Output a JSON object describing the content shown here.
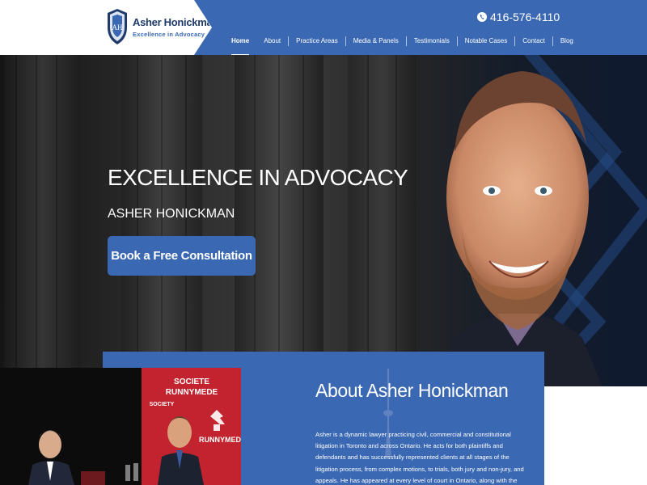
{
  "brand": {
    "name": "Asher Honickman",
    "tagline": "Excellence in Advocacy",
    "monogram": "AH",
    "icon": "shield-logo-icon",
    "colors": {
      "primary": "#3a68b3",
      "navy": "#1f3a6b"
    }
  },
  "header": {
    "phone": "416-576-4110",
    "phone_icon": "phone-icon"
  },
  "nav": {
    "items": [
      {
        "label": "Home",
        "active": true
      },
      {
        "label": "About"
      },
      {
        "label": "Practice Areas"
      },
      {
        "label": "Media & Panels"
      },
      {
        "label": "Testimonials"
      },
      {
        "label": "Notable Cases"
      },
      {
        "label": "Contact"
      },
      {
        "label": "Blog"
      }
    ]
  },
  "hero": {
    "title": "EXCELLENCE IN ADVOCACY",
    "subtitle": "ASHER HONICKMAN",
    "cta_label": "Book a Free Consultation"
  },
  "photo": {
    "banner_text_1": "SOCIETE",
    "banner_text_2": "RUNNYMEDE",
    "banner_text_3": "SOCIETY"
  },
  "about": {
    "title": "About Asher Honickman",
    "body": "Asher is a dynamic lawyer practicing civil, commercial and constitutional litigation in Toronto and across Ontario. He acts for both plaintiffs and defendants and has successfully represented clients at all stages of the litigation process, from complex motions, to trials, both jury and non-jury, and appeals. He has appeared at every level of court in Ontario, along with the Supreme Court of Canada."
  }
}
